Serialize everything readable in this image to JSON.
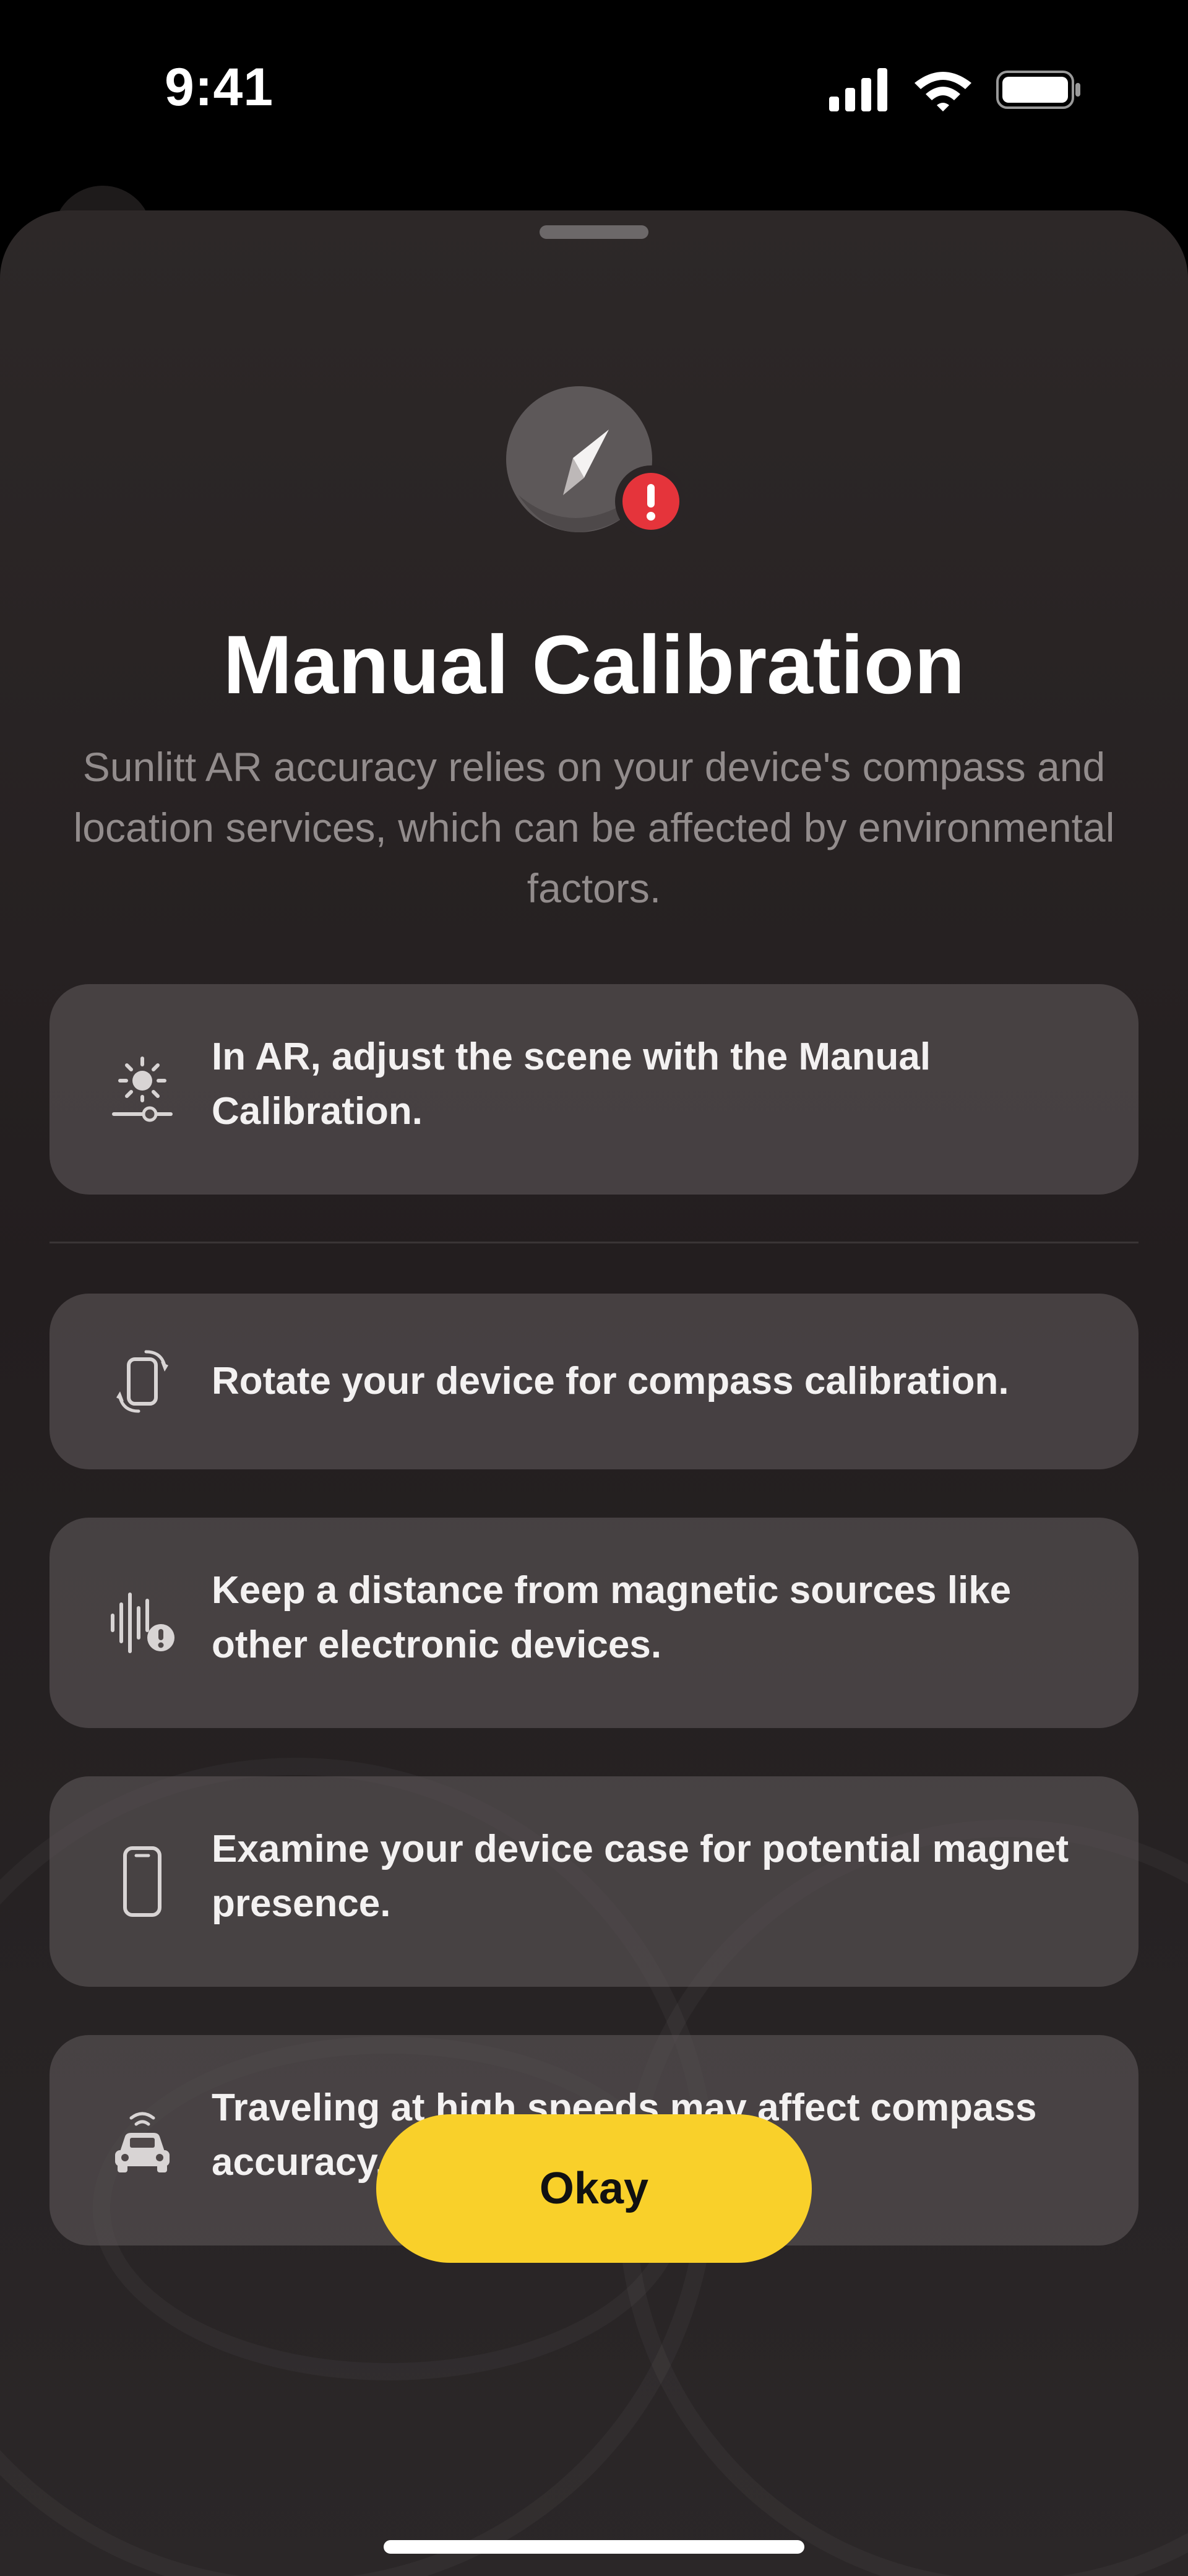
{
  "status_bar": {
    "time": "9:41",
    "icons": [
      "cellular-signal-icon",
      "wifi-icon",
      "battery-icon"
    ]
  },
  "sheet": {
    "icon": "compass-warning-icon",
    "title": "Manual Calibration",
    "subtitle": "Sunlitt AR accuracy relies on your device's compass and location services, which can be affected by environmental factors."
  },
  "tips": [
    {
      "icon": "sun-slider-icon",
      "text": "In AR, adjust the scene with the Manual Calibration."
    },
    {
      "icon": "rotate-device-icon",
      "text": "Rotate your device for compass calibration."
    },
    {
      "icon": "magnetic-warning-icon",
      "text": "Keep a distance from magnetic sources like other electronic devices."
    },
    {
      "icon": "phone-case-icon",
      "text": "Examine your device case for potential magnet presence."
    },
    {
      "icon": "car-speed-icon",
      "text": "Traveling at high speeds may affect compass accuracy."
    }
  ],
  "actions": {
    "okay_label": "Okay"
  },
  "colors": {
    "accent": "#f9d02a",
    "warning": "#e5343b",
    "card_background": "#4f4849",
    "sheet_background": "#272223"
  }
}
